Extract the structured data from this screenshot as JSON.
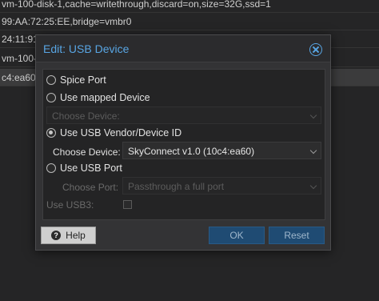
{
  "background": {
    "rows": [
      "vm-100-disk-1,cache=writethrough,discard=on,size=32G,ssd=1",
      "99:AA:72:25:EE,bridge=vmbr0",
      "24:11:91",
      "vm-100-",
      "c4:ea60"
    ]
  },
  "dialog": {
    "title": "Edit: USB Device",
    "options": {
      "spice": "Spice Port",
      "mapped": "Use mapped Device",
      "vendor": "Use USB Vendor/Device ID",
      "port": "Use USB Port"
    },
    "mapped_choose": "Choose Device:",
    "device_label": "Choose Device:",
    "device_value": "SkyConnect v1.0 (10c4:ea60)",
    "port_label": "Choose Port:",
    "port_value": "Passthrough a full port",
    "usb3_label": "Use USB3:",
    "buttons": {
      "help": "Help",
      "ok": "OK",
      "reset": "Reset"
    }
  },
  "colors": {
    "accent": "#58a5e3",
    "primary_button": "#1f4b73"
  }
}
